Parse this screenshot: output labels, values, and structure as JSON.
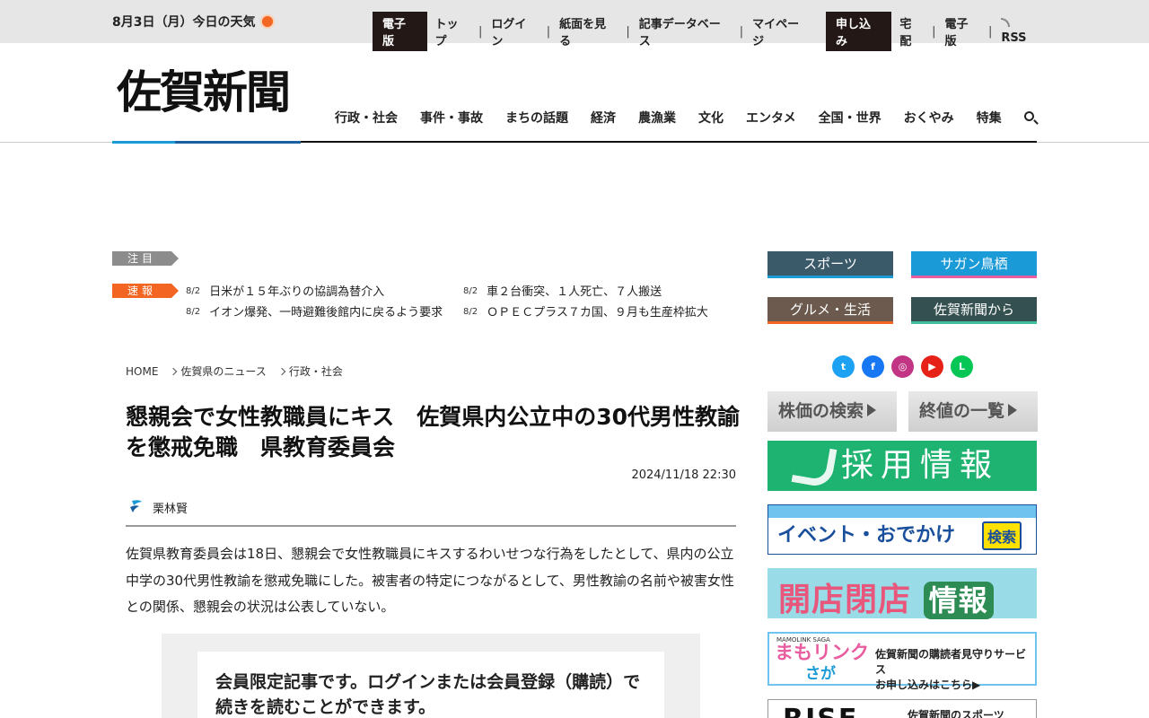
{
  "topbar": {
    "weather": "8月3日（月）今日の天気",
    "digital_tag": "電子版",
    "links": [
      "トップ",
      "ログイン",
      "紙面を見る",
      "記事データベース",
      "マイページ"
    ],
    "apply_tag": "申し込み",
    "apply_links": [
      "宅配",
      "電子版"
    ],
    "rss": "RSS"
  },
  "header": {
    "logo": "佐賀新聞",
    "nav": [
      "行政・社会",
      "事件・事故",
      "まちの話題",
      "経済",
      "農漁業",
      "文化",
      "エンタメ",
      "全国・世界",
      "おくやみ",
      "特集"
    ]
  },
  "ticker": {
    "attention_label": "注目",
    "breaking_label": "速報",
    "items": [
      {
        "date": "8/2",
        "text": "日米が１５年ぶりの協調為替介入"
      },
      {
        "date": "8/2",
        "text": "イオン爆発、一時避難後館内に戻るよう要求"
      },
      {
        "date": "8/2",
        "text": "車２台衝突、１人死亡、７人搬送"
      },
      {
        "date": "8/2",
        "text": "ＯＰＥＣプラス７カ国、９月も生産枠拡大"
      }
    ]
  },
  "breadcrumb": [
    "HOME",
    "佐賀県のニュース",
    "行政・社会"
  ],
  "article": {
    "title": "懇親会で女性教職員にキス　佐賀県内公立中の30代男性教諭を懲戒免職　県教育委員会",
    "date": "2024/11/18 22:30",
    "author": "栗林賢",
    "body": "佐賀県教育委員会は18日、懇親会で女性教職員にキスするわいせつな行為をしたとして、県内の公立中学の30代男性教諭を懲戒免職にした。被害者の特定につながるとして、男性教諭の名前や被害女性との関係、懇親会の状況は公表していない。",
    "paywall": "会員限定記事です。ログインまたは会員登録（購読）で続きを読むことができます。"
  },
  "sidebar": {
    "categories": [
      "スポーツ",
      "サガン鳥栖",
      "グルメ・生活",
      "佐賀新聞から"
    ],
    "social_icons": [
      "twitter-icon",
      "facebook-icon",
      "instagram-icon",
      "youtube-icon",
      "line-icon"
    ],
    "stock_search": "株価の検索",
    "stock_close": "終値の一覧",
    "recruit": "採用情報",
    "event_text": "イベント・おでかけ",
    "event_btn": "検索",
    "shop_a": "開店",
    "shop_b": "閉店",
    "shop_c": "情報",
    "mamo_en": "MAMOLINK SAGA",
    "mamo_logo1": "まもリンク",
    "mamo_logo2": "さが",
    "mamo_desc1": "佐賀新聞の購読者見守りサービス",
    "mamo_desc2": "お申し込みはこちら▶",
    "rise_big": "RISE",
    "rise_small": "佐賀新聞のスポーツ"
  }
}
